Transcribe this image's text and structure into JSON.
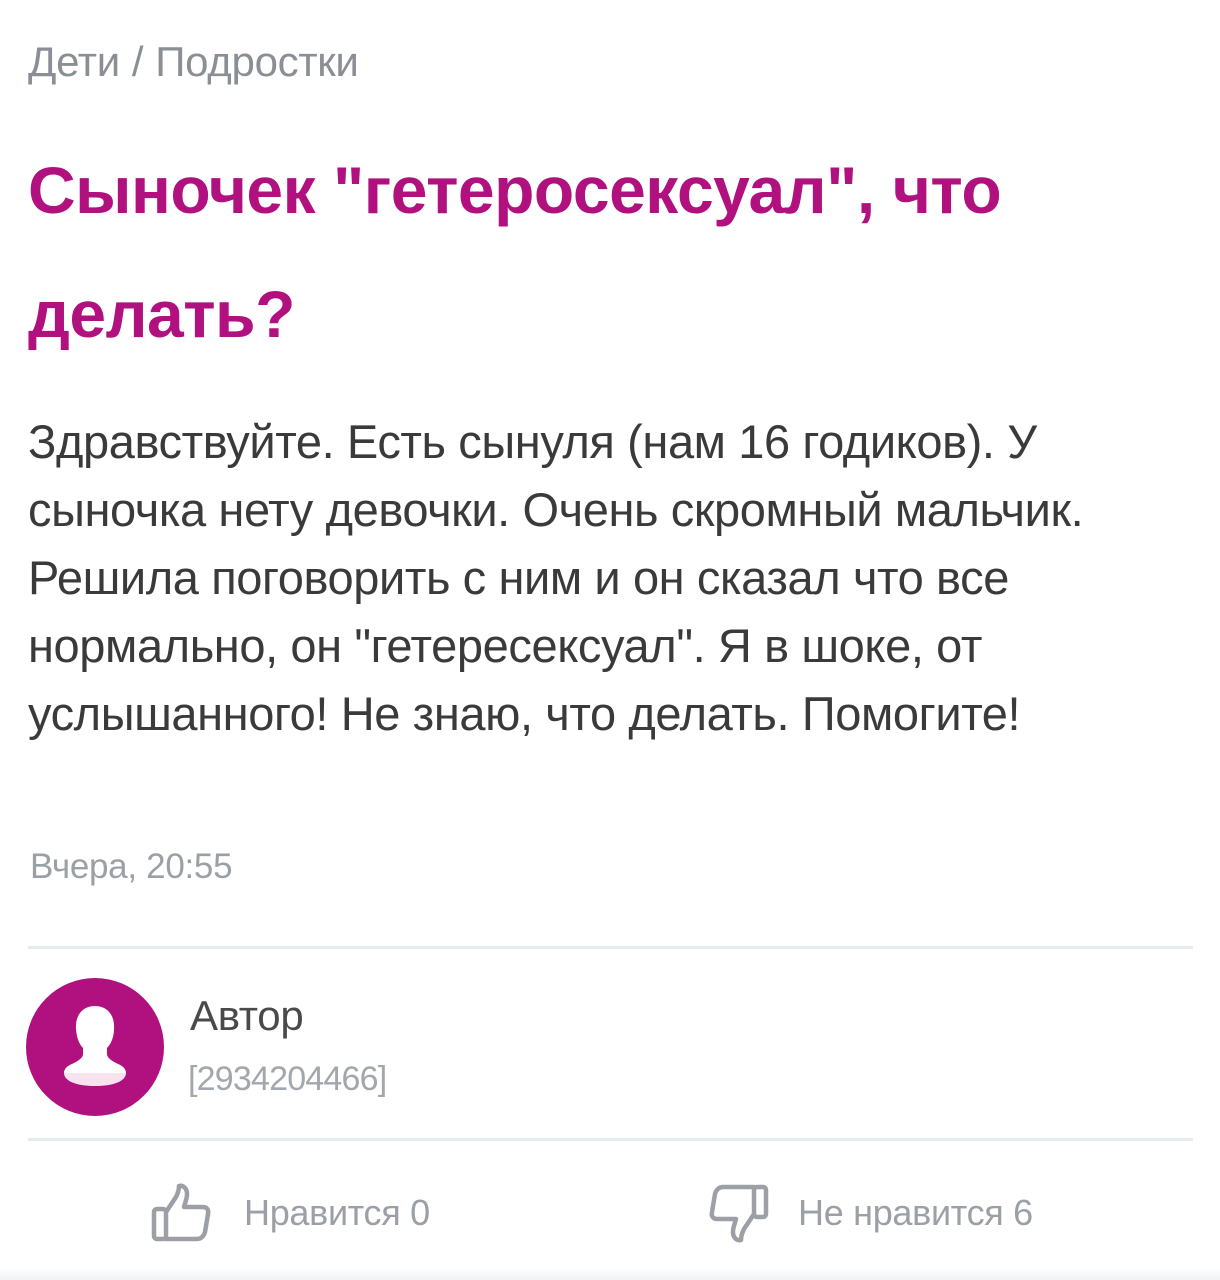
{
  "breadcrumb": {
    "category": "Дети",
    "separator": "/",
    "subcategory": "Подростки"
  },
  "post": {
    "title": "Сыночек \"гетеросексуал\", что делать?",
    "body": "Здравствуйте. Есть сынуля (нам 16 годиков). У сыночка нету девочки. Очень скромный мальчик. Решила поговорить с ним и он сказал что все нормально, он \"гетересексуал\". Я в шоке, от услышанного! Не знаю, что делать. Помогите!",
    "timestamp": "Вчера, 20:55"
  },
  "author": {
    "name": "Автор",
    "id": "[2934204466]",
    "avatar_icon": "user-silhouette-icon"
  },
  "reactions": {
    "like_label": "Нравится 0",
    "like_icon": "thumbs-up-icon",
    "dislike_label": "Не нравится 6",
    "dislike_icon": "thumbs-down-icon"
  },
  "colors": {
    "accent": "#b0117e",
    "text": "#3a3a3a",
    "muted": "#9aa0a6",
    "divider": "#e8ebee"
  }
}
